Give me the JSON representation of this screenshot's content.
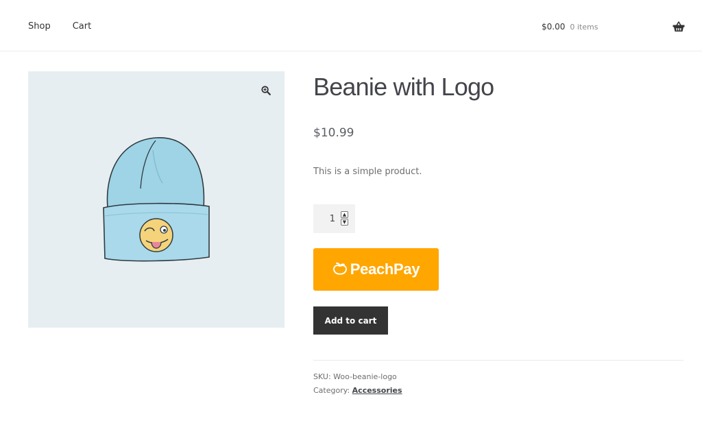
{
  "header": {
    "nav": [
      {
        "label": "Shop"
      },
      {
        "label": "Cart"
      }
    ],
    "cart_total": "$0.00",
    "cart_count": "0 items",
    "basket_icon": "basket-icon"
  },
  "product": {
    "title": "Beanie with Logo",
    "price": "$10.99",
    "description": "This is a simple product.",
    "quantity": "1",
    "peachpay_label": "PeachPay",
    "add_to_cart_label": "Add to cart",
    "sku_label": "SKU:",
    "sku_value": "Woo-beanie-logo",
    "category_label": "Category:",
    "category_value": "Accessories"
  },
  "colors": {
    "peachpay": "#ffa600",
    "button_dark": "#333333",
    "image_bg": "#e7eef1",
    "beanie": "#9fd3e6"
  },
  "icons": [
    "zoom-icon",
    "basket-icon",
    "peach-logo-icon",
    "spin-up-icon",
    "spin-down-icon"
  ]
}
